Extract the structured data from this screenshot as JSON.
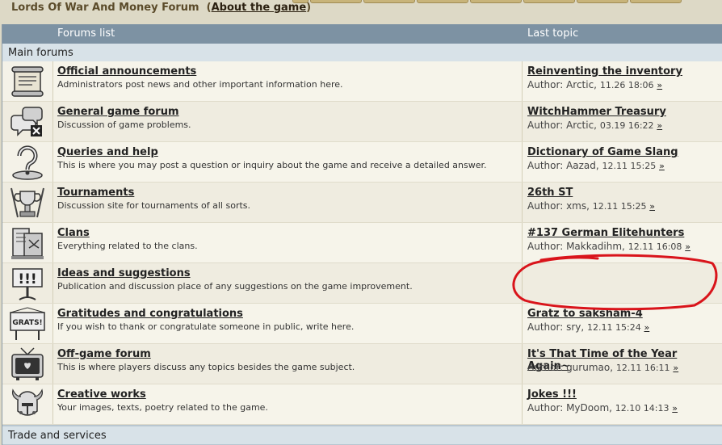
{
  "topbar": {
    "title_prefix": "Lords Of War And Money Forum",
    "about_open": "(",
    "about_link": "About the game",
    "about_close": ")"
  },
  "header": {
    "forums_list": "Forums list",
    "last_topic": "Last topic"
  },
  "sections": {
    "main": "Main forums",
    "trade": "Trade and services"
  },
  "forums": [
    {
      "icon": "scroll-announcement-icon",
      "name": "Official announcements",
      "desc": "Administrators post news and other important information here.",
      "last_title": "Reinventing the inventory",
      "author_label": "Author:",
      "author": "Arctic,",
      "date": "11.26 18:06",
      "go": "»"
    },
    {
      "icon": "speech-bubbles-icon",
      "name": "General game forum",
      "desc": "Discussion of game problems.",
      "last_title": "WitchHammer Treasury",
      "author_label": "Author:",
      "author": "Arctic,",
      "date": "03.19 16:22",
      "go": "»"
    },
    {
      "icon": "question-mark-icon",
      "name": "Queries and help",
      "desc": "This is where you may post a question or inquiry about the game and receive a detailed answer.",
      "last_title": "Dictionary of Game Slang",
      "author_label": "Author:",
      "author": "Aazad,",
      "date": "12.11 15:25",
      "go": "»"
    },
    {
      "icon": "trophy-icon",
      "name": "Tournaments",
      "desc": "Discussion site for tournaments of all sorts.",
      "last_title": "26th ST",
      "author_label": "Author:",
      "author": "xms,",
      "date": "12.11 15:25",
      "go": "»"
    },
    {
      "icon": "clan-banner-icon",
      "name": "Clans",
      "desc": "Everything related to the clans.",
      "last_title": "#137 German Elitehunters",
      "author_label": "Author:",
      "author": "Makkadihm,",
      "date": "12.11 16:08",
      "go": "»"
    },
    {
      "icon": "exclamation-sign-icon",
      "name": "Ideas and suggestions",
      "desc": "Publication and discussion place of any suggestions on the game improvement.",
      "last_title": "",
      "author_label": "",
      "author": "",
      "date": "",
      "go": ""
    },
    {
      "icon": "gratz-sign-icon",
      "name": "Gratitudes and congratulations",
      "desc": "If you wish to thank or congratulate someone in public, write here.",
      "last_title": "Gratz to saksham-4",
      "author_label": "Author:",
      "author": "sry,",
      "date": "12.11 15:24",
      "go": "»"
    },
    {
      "icon": "tv-icon",
      "name": "Off-game forum",
      "desc": "This is where players discuss any topics besides the game subject.",
      "last_title": "It's That Time of the Year Again~",
      "author_label": "Author:",
      "author": "gurumao,",
      "date": "12.11 16:11",
      "go": "»"
    },
    {
      "icon": "helmet-icon",
      "name": "Creative works",
      "desc": "Your images, texts, poetry related to the game.",
      "last_title": "Jokes !!!",
      "author_label": "Author:",
      "author": "MyDoom,",
      "date": "12.10 14:13",
      "go": "»"
    }
  ],
  "colors": {
    "header_bg": "#7d92a3",
    "section_bg": "#d8e2e8",
    "row_bg": "#f6f4ea",
    "annotation_red": "#d9141b"
  }
}
